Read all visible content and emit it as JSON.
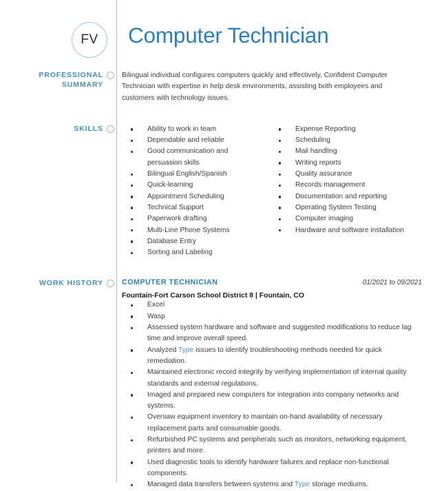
{
  "document": {
    "type": "resume",
    "monogram": "FV",
    "title": "Computer Technician",
    "accent_color": "#2a7fc4",
    "label_color": "#3f8fc4",
    "rail_color": "#b8b8b8"
  },
  "sections": {
    "summary": {
      "label_line1": "PROFESSIONAL",
      "label_line2": "SUMMARY",
      "text": "Bilingual individual configures computers quickly and effectively. Confident Computer Technician with expertise in help desk environments, assisting both employees and customers with technology issues."
    },
    "skills": {
      "label": "SKILLS",
      "column_left": [
        "Ability to work in team",
        "Dependable and reliable",
        "Good communication and persuasion skills",
        "Bilingual English/Spanish",
        "Quick-learning",
        "Appointment Scheduling",
        "Technical Support",
        "Paperwork drafting",
        "Multi-Line Phone Systems",
        "Database Entry",
        "Sorting and Labeling"
      ],
      "column_right": [
        "Expense Reporting",
        "Scheduling",
        "Mail handling",
        "Writing reports",
        "Quality assurance",
        "Records management",
        "Documentation and reporting",
        "Operating System Testing",
        "Computer imaging",
        "Hardware and software installation"
      ]
    },
    "work_history": {
      "label": "WORK HISTORY",
      "jobs": [
        {
          "title": "COMPUTER TECHNICIAN",
          "dates": "01/2021 to 09/2021",
          "employer": "Fountain-Fort Carson School District 8 | Fountain, CO",
          "bullets": [
            {
              "pre": "Excel",
              "placeholder": "",
              "post": ""
            },
            {
              "pre": "Wasp",
              "placeholder": "",
              "post": ""
            },
            {
              "pre": "Assessed system hardware and software and suggested modifications to reduce lag time and improve overall speed.",
              "placeholder": "",
              "post": ""
            },
            {
              "pre": "Analyzed ",
              "placeholder": "Type",
              "post": " issues to identify troubleshooting methods needed for quick remediation."
            },
            {
              "pre": "Maintained electronic record integrity by verifying implementation of internal quality standards and external regulations.",
              "placeholder": "",
              "post": ""
            },
            {
              "pre": "Imaged and prepared new computers for integration into company networks and systems.",
              "placeholder": "",
              "post": ""
            },
            {
              "pre": "Oversaw equipment inventory to maintain on-hand availability of necessary replacement parts and consumable goods.",
              "placeholder": "",
              "post": ""
            },
            {
              "pre": "Refurbished PC systems and peripherals such as monitors, networking equipment, printers and more.",
              "placeholder": "",
              "post": ""
            },
            {
              "pre": "Used diagnostic tools to identify hardware failures and replace non-functional components.",
              "placeholder": "",
              "post": ""
            },
            {
              "pre": "Managed data transfers between systems and ",
              "placeholder": "Type",
              "post": " storage mediums."
            }
          ]
        }
      ]
    }
  }
}
